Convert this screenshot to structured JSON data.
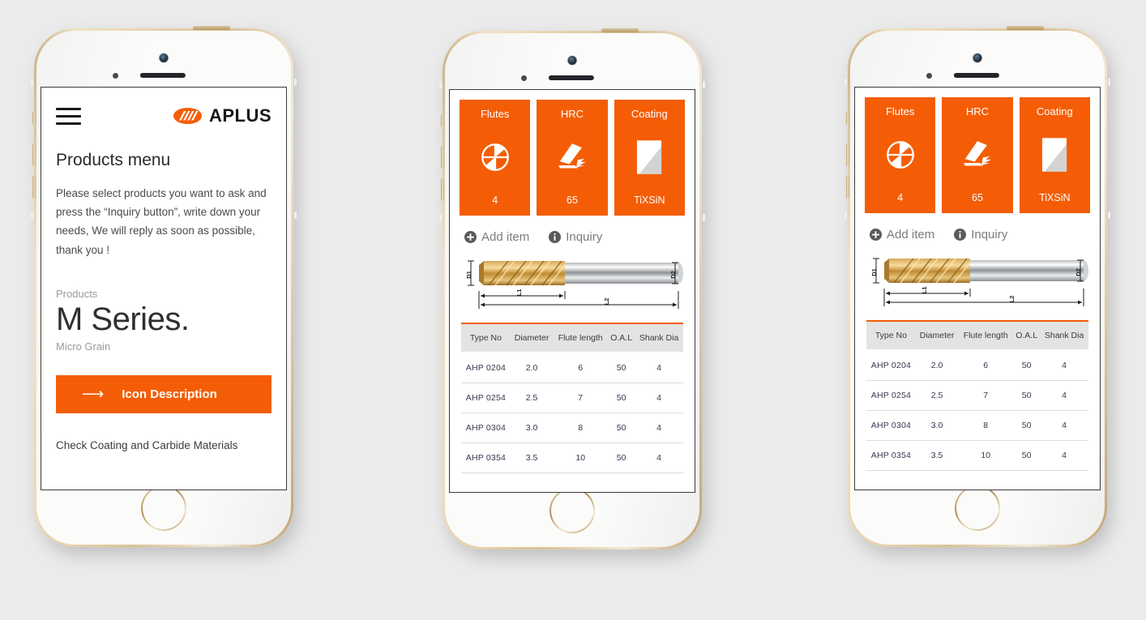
{
  "background_color": "#ebebeb",
  "accent_color": "#f45d05",
  "phones": [
    {
      "id": "phone-1",
      "screen": "products-menu",
      "brand": {
        "name": "APLUS",
        "mark": "aplus-logo-mark"
      },
      "menu_icon": "hamburger-menu-icon",
      "page_title": "Products menu",
      "intro": "Please select products you want to ask and press the “Inquiry button”, write down your needs, We will reply as soon as possible, thank you !",
      "eyebrow": "Products",
      "series_title": "M Series.",
      "series_subtitle": "Micro Grain",
      "cta": {
        "label": "Icon Description",
        "icon": "arrow-right-icon"
      },
      "footer_link": "Check Coating and Carbide Materials"
    },
    {
      "id": "phone-2",
      "screen": "product-detail",
      "spec_cards": [
        {
          "title": "Flutes",
          "icon": "flute-cross-section-icon",
          "value": "4"
        },
        {
          "title": "HRC",
          "icon": "cutting-tool-icon",
          "value": "65"
        },
        {
          "title": "Coating",
          "icon": "coating-layer-icon",
          "value": "TiXSiN"
        }
      ],
      "actions": [
        {
          "label": "Add item",
          "icon": "plus-circle-icon"
        },
        {
          "label": "Inquiry",
          "icon": "info-circle-icon"
        }
      ],
      "tool_diagram": {
        "name": "end-mill-diagram",
        "labels": {
          "d1": "D1",
          "d2": "D2",
          "l1": "L1",
          "l2": "L2"
        }
      },
      "table": {
        "columns": [
          "Type No",
          "Diameter",
          "Flute length",
          "O.A.L",
          "Shank Dia"
        ],
        "rows": [
          [
            "AHP 0204",
            "2.0",
            "6",
            "50",
            "4"
          ],
          [
            "AHP 0254",
            "2.5",
            "7",
            "50",
            "4"
          ],
          [
            "AHP 0304",
            "3.0",
            "8",
            "50",
            "4"
          ],
          [
            "AHP 0354",
            "3.5",
            "10",
            "50",
            "4"
          ]
        ]
      }
    },
    {
      "id": "phone-3",
      "screen": "product-detail",
      "spec_cards": [
        {
          "title": "Flutes",
          "icon": "flute-cross-section-icon",
          "value": "4"
        },
        {
          "title": "HRC",
          "icon": "cutting-tool-icon",
          "value": "65"
        },
        {
          "title": "Coating",
          "icon": "coating-layer-icon",
          "value": "TiXSiN"
        }
      ],
      "actions": [
        {
          "label": "Add item",
          "icon": "plus-circle-icon"
        },
        {
          "label": "Inquiry",
          "icon": "info-circle-icon"
        }
      ],
      "tool_diagram": {
        "name": "end-mill-diagram",
        "labels": {
          "d1": "D1",
          "d2": "D2",
          "l1": "L1",
          "l2": "L2"
        }
      },
      "table": {
        "columns": [
          "Type No",
          "Diameter",
          "Flute length",
          "O.A.L",
          "Shank Dia"
        ],
        "rows": [
          [
            "AHP 0204",
            "2.0",
            "6",
            "50",
            "4"
          ],
          [
            "AHP 0254",
            "2.5",
            "7",
            "50",
            "4"
          ],
          [
            "AHP 0304",
            "3.0",
            "8",
            "50",
            "4"
          ],
          [
            "AHP 0354",
            "3.5",
            "10",
            "50",
            "4"
          ]
        ]
      }
    }
  ]
}
